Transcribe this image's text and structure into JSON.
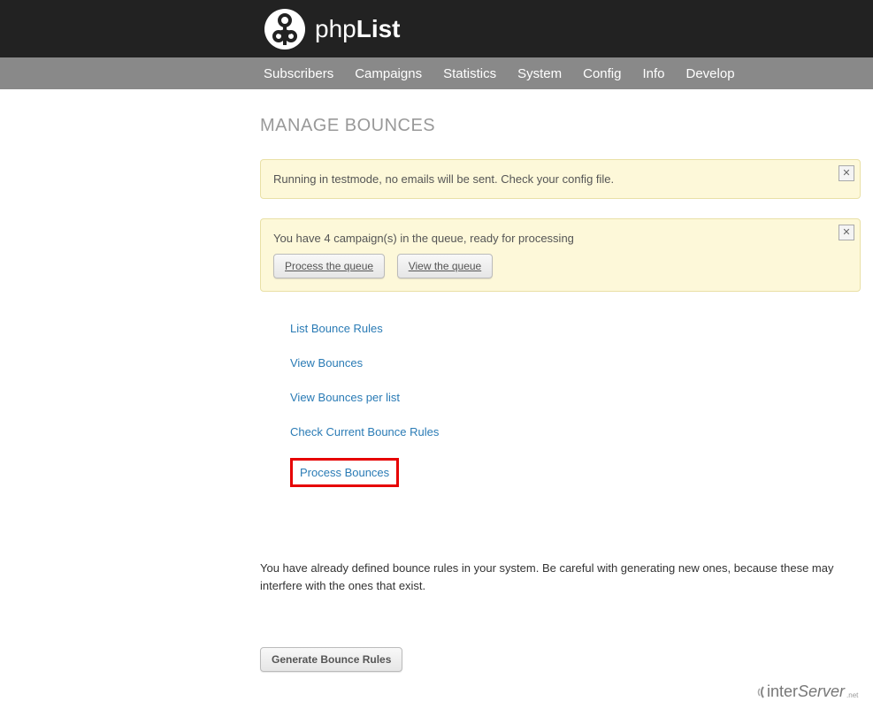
{
  "logo": {
    "text_part1": "php",
    "text_part2": "List"
  },
  "nav": {
    "items": [
      "Subscribers",
      "Campaigns",
      "Statistics",
      "System",
      "Config",
      "Info",
      "Develop"
    ]
  },
  "page": {
    "title": "MANAGE BOUNCES"
  },
  "notices": {
    "testmode": {
      "message": "Running in testmode, no emails will be sent. Check your config file."
    },
    "queue": {
      "message": "You have 4 campaign(s) in the queue, ready for processing",
      "process_label": "Process the queue",
      "view_label": "View the queue"
    }
  },
  "bounce_links": {
    "list_rules": "List Bounce Rules",
    "view_bounces": "View Bounces",
    "view_per_list": "View Bounces per list",
    "check_rules": "Check Current Bounce Rules",
    "process_bounces": "Process Bounces"
  },
  "warning": "You have already defined bounce rules in your system. Be careful with generating new ones, because these may interfere with the ones that exist.",
  "generate_button": "Generate Bounce Rules",
  "footer": {
    "brand_part1": "inter",
    "brand_part2": "Server",
    "tld": ".net"
  }
}
